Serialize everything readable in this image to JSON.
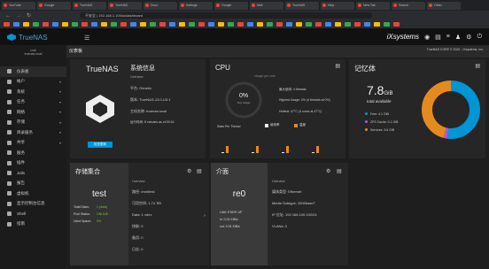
{
  "browser": {
    "tabs": [
      "YouTube",
      "Google",
      "TrueNAS",
      "TrueNAS",
      "Docs",
      "Settings",
      "Google",
      "Mail",
      "TrueNAS",
      "Help",
      "New Tab",
      "Search",
      "Other"
    ],
    "url": "不安全 | 192.168.1.100/ui/dashboard"
  },
  "header": {
    "logo": "TrueNAS",
    "ix_logo": "iXsystems"
  },
  "sidebar": {
    "user": [
      "root",
      "truenas.local"
    ],
    "items": [
      {
        "label": "仪表板"
      },
      {
        "label": "帐户"
      },
      {
        "label": "系统"
      },
      {
        "label": "任务"
      },
      {
        "label": "网络"
      },
      {
        "label": "存储"
      },
      {
        "label": "目录服务"
      },
      {
        "label": "共享"
      },
      {
        "label": "服务"
      },
      {
        "label": "插件"
      },
      {
        "label": "Jails"
      },
      {
        "label": "报告"
      },
      {
        "label": "虚拟机"
      },
      {
        "label": "显示控制台信息"
      },
      {
        "label": "Shell"
      },
      {
        "label": "指南"
      }
    ]
  },
  "breadcrumb": "仪表板",
  "breadcrumb_right": "TrueNAS CORE © 2022 - iXsystems, Inc.",
  "sysinfo": {
    "title": "系统信息",
    "brand": "TrueNAS",
    "section": "Overview",
    "rows": [
      "平台: Generic",
      "版本: TrueNAS-13.0-U3.1",
      "主机名称: truenas.local",
      "运行时间: 8 minutes as of 00:16"
    ],
    "update_button": "检查更新"
  },
  "cpu": {
    "title": "CPU",
    "gauge_value": "0%",
    "gauge_label": "Avg Usage",
    "header": "Usage per core",
    "rows": [
      "最大使用: 4 threads",
      "Highest Usage: 0% (4 threads at 0%)",
      "Hottest: 47°C (4 cores at 47°C)"
    ],
    "legend": [
      "Stats Per Thread",
      "使用率",
      "温度"
    ],
    "bars": [
      0,
      0,
      0,
      0,
      0,
      0,
      0,
      0
    ],
    "temps": [
      0.35,
      0.35,
      0.35,
      0.35
    ]
  },
  "memory": {
    "title": "记忆体",
    "value": "7.8",
    "unit": "GiB",
    "label": "total available",
    "legend": [
      {
        "label": "Free: 4.1 GiB",
        "color": "#0095d5"
      },
      {
        "label": "ZFS Cache: 0.1 GiB",
        "color": "#c34fd2"
      },
      {
        "label": "Services: 3.6 GiB",
        "color": "#e58a1f"
      }
    ],
    "donut": [
      0.52,
      0.02,
      0.46
    ]
  },
  "pool": {
    "title": "存储集合",
    "name": "test",
    "rows": [
      {
        "k": "Total Disks:",
        "v": "1 (data)"
      },
      {
        "k": "Pool Status:",
        "v": "ONLINE"
      },
      {
        "k": "Used Space:",
        "v": "0%"
      }
    ],
    "overview": "Overview",
    "details": [
      "路径: /mnt/test",
      "可用空间: 1.74 TiB",
      "Data: 1 vdev",
      "快取: 0",
      "备用: 0",
      "日志: 0"
    ]
  },
  "interface": {
    "title": "介面",
    "name": "re0",
    "rows": [
      "LINK STATE UP",
      "in: 0.01 KiB/s",
      "out: 0.01 KiB/s"
    ],
    "overview": "Overview",
    "details": [
      "媒体类型: Ethernet",
      "Media Subtype: 1000baseT",
      "IP 位址: 192.168.100.102/24",
      "VLANs: 0"
    ]
  }
}
